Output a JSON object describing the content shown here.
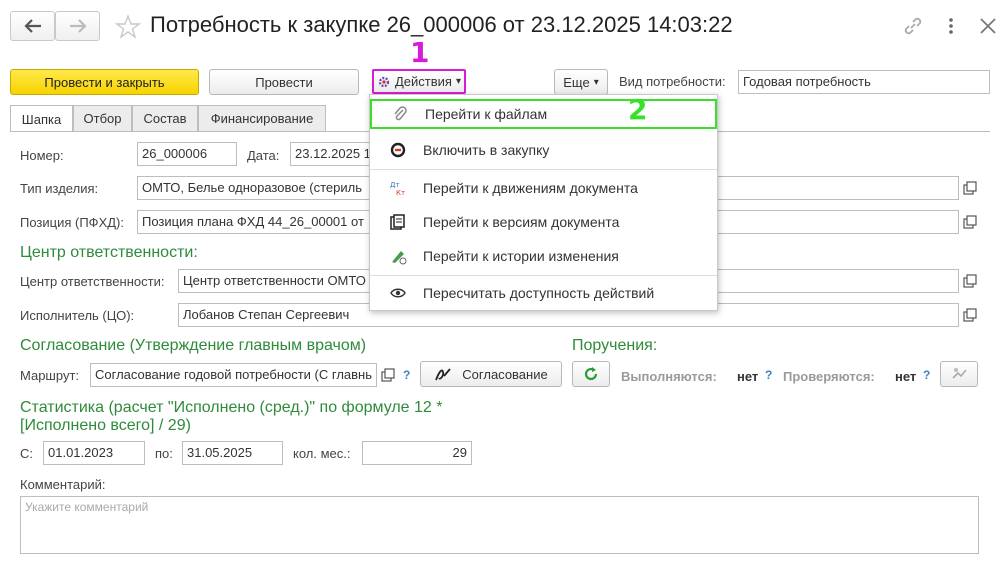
{
  "window": {
    "title": "Потребность к закупке 26_000006 от 23.12.2025 14:03:22"
  },
  "toolbar": {
    "post_close": "Провести и закрыть",
    "post": "Провести",
    "actions": "Действия",
    "more": "Еще",
    "need_type_label": "Вид потребности:",
    "need_type_value": "Годовая потребность"
  },
  "tabs": [
    "Шапка",
    "Отбор",
    "Состав",
    "Финансирование"
  ],
  "form": {
    "number_label": "Номер:",
    "number_value": "26_000006",
    "date_label": "Дата:",
    "date_value": "23.12.2025 1",
    "product_type_label": "Тип изделия:",
    "product_type_value": "ОМТО, Белье одноразовое (стериль",
    "position_label": "Позиция (ПФХД):",
    "position_value": "Позиция плана ФХД 44_26_00001 от",
    "resp_section": "Центр ответственности:",
    "resp_center_label": "Центр ответственности:",
    "resp_center_value": "Центр ответственности ОМТО",
    "executor_label": "Исполнитель (ЦО):",
    "executor_value": "Лобанов Степан Сергеевич",
    "approval_section": "Согласование (Утверждение главным врачом)",
    "route_label": "Маршрут:",
    "route_value": "Согласование годовой потребности (С главнь",
    "approval_button": "Согласование",
    "orders_section": "Поручения:",
    "executing_label": "Выполняются:",
    "executing_value": "нет",
    "checking_label": "Проверяются:",
    "checking_value": "нет",
    "help": "?",
    "stats_section_line1": "Статистика (расчет \"Исполнено (сред.)\" по формуле 12 *",
    "stats_section_line2": "[Исполнено всего] / 29)",
    "from_label": "С:",
    "from_value": "01.01.2023",
    "to_label": "по:",
    "to_value": "31.05.2025",
    "months_label": "кол. мес.:",
    "months_value": "29",
    "comment_label": "Комментарий:",
    "comment_placeholder": "Укажите комментарий"
  },
  "menu": {
    "items": [
      {
        "label": "Перейти к файлам",
        "icon": "paperclip-icon"
      },
      {
        "label": "Включить в закупку",
        "icon": "include-procurement-icon"
      },
      {
        "label": "Перейти к движениям документа",
        "icon": "debit-credit-icon"
      },
      {
        "label": "Перейти к версиям документа",
        "icon": "versions-icon"
      },
      {
        "label": "Перейти к истории изменения",
        "icon": "history-icon"
      },
      {
        "label": "Пересчитать доступность действий",
        "icon": "eye-icon"
      }
    ]
  },
  "annotations": {
    "marker1": "1",
    "marker2": "2",
    "color1": "#d81bd8",
    "color2": "#39e02a"
  },
  "colors": {
    "primary_button": "#f7d300",
    "section_green": "#2e8b3a",
    "help_blue": "#3f7fc4"
  }
}
